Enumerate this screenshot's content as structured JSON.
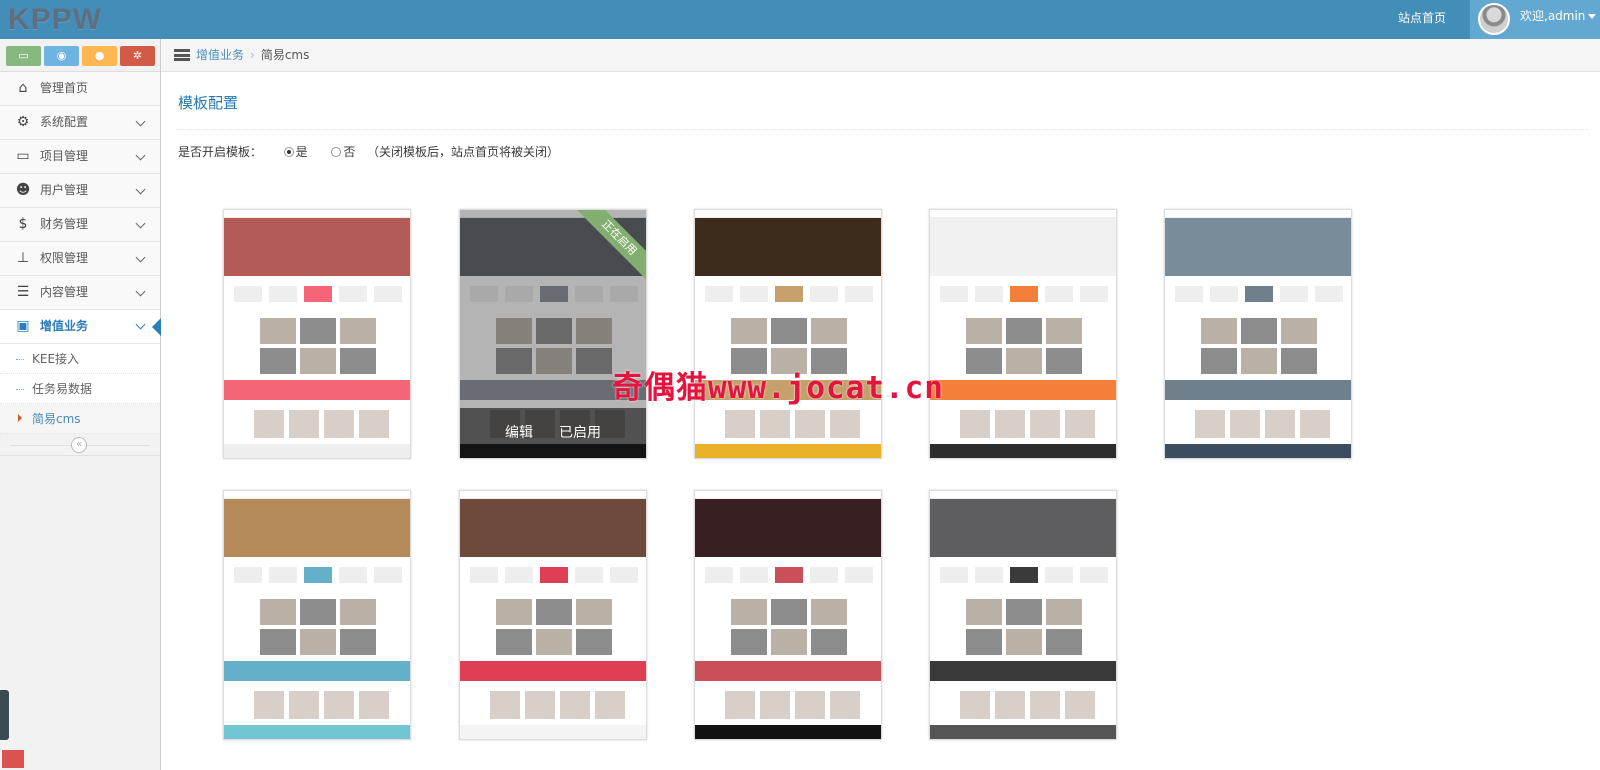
{
  "header": {
    "logo": "KPPW",
    "site_home": "站点首页",
    "welcome": "欢迎,admin"
  },
  "sidebar": {
    "shortcuts": [
      {
        "icon": "laptop-icon",
        "color": "#87b87f",
        "glyph": "▭"
      },
      {
        "icon": "eye-icon",
        "color": "#6fb3e0",
        "glyph": "◉"
      },
      {
        "icon": "user-icon",
        "color": "#ffb752",
        "glyph": "●"
      },
      {
        "icon": "cogs-icon",
        "color": "#d15b47",
        "glyph": "✲"
      }
    ],
    "items": [
      {
        "label": "管理首页",
        "icon": "home-icon",
        "glyph": "⌂"
      },
      {
        "label": "系统配置",
        "icon": "cog-icon",
        "glyph": "⚙"
      },
      {
        "label": "项目管理",
        "icon": "desktop-icon",
        "glyph": "▭"
      },
      {
        "label": "用户管理",
        "icon": "group-icon",
        "glyph": "☻"
      },
      {
        "label": "财务管理",
        "icon": "dollar-icon",
        "glyph": "$"
      },
      {
        "label": "权限管理",
        "icon": "sitemap-icon",
        "glyph": "⊥"
      },
      {
        "label": "内容管理",
        "icon": "list-icon",
        "glyph": "☰"
      },
      {
        "label": "增值业务",
        "icon": "briefcase-icon",
        "glyph": "▣"
      }
    ],
    "subitems": [
      "KEE接入",
      "任务易数据",
      "简易cms"
    ]
  },
  "breadcrumb": {
    "parent": "增值业务",
    "current": "简易cms"
  },
  "page": {
    "title": "模板配置",
    "toggle_label": "是否开启模板：",
    "option_yes": "是",
    "option_no": "否",
    "note": "（关闭模板后，站点首页将被关闭）",
    "selected": "yes"
  },
  "templates": [
    {
      "id": 1,
      "banner": "#b35b56",
      "accent": "#f46677",
      "footer": "#eeeeee"
    },
    {
      "id": 2,
      "banner": "#5a6068",
      "accent": "#8d939b",
      "footer": "#2e3033",
      "active": true,
      "ribbon": "正在启用",
      "edit_label": "编辑",
      "enabled_label": "已启用"
    },
    {
      "id": 3,
      "banner": "#3d2c1b",
      "accent": "#c6a06c",
      "footer": "#e8b32a"
    },
    {
      "id": 4,
      "banner": "#f1f1f1",
      "accent": "#f47f3a",
      "footer": "#2c2c2c"
    },
    {
      "id": 5,
      "banner": "#798c99",
      "accent": "#6f7f8b",
      "footer": "#3b4d5f"
    },
    {
      "id": 6,
      "banner": "#b48a5a",
      "accent": "#63b0c8",
      "footer": "#70c6d2"
    },
    {
      "id": 7,
      "banner": "#6d4a3c",
      "accent": "#de3f54",
      "footer": "#f4f4f4"
    },
    {
      "id": 8,
      "banner": "#3a1f22",
      "accent": "#c94f5b",
      "footer": "#111111"
    },
    {
      "id": 9,
      "banner": "#5e5e60",
      "accent": "#3a3a3a",
      "footer": "#555555"
    }
  ],
  "watermark": "奇偶猫www.jocat.cn"
}
